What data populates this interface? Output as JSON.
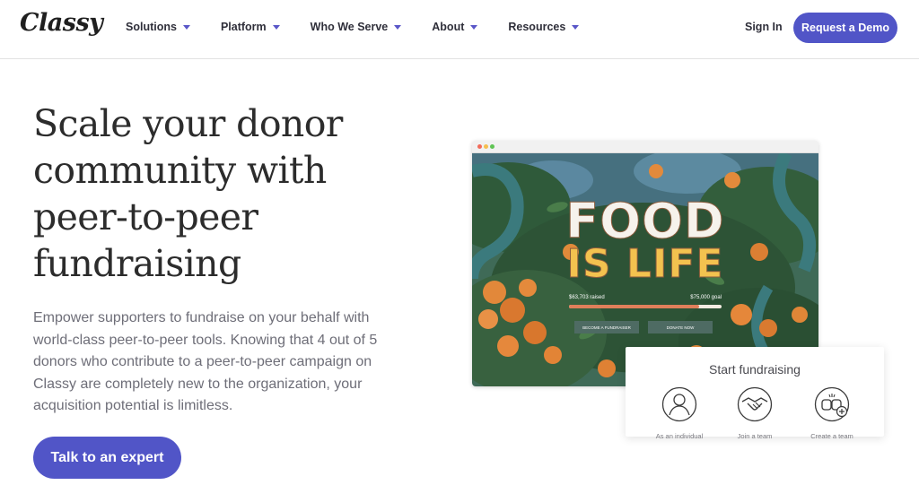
{
  "header": {
    "logo": "Classy",
    "nav": [
      {
        "label": "Solutions"
      },
      {
        "label": "Platform"
      },
      {
        "label": "Who We Serve"
      },
      {
        "label": "About"
      },
      {
        "label": "Resources"
      }
    ],
    "sign_in": "Sign In",
    "demo_button": "Request a Demo"
  },
  "hero": {
    "title": "Scale your donor community with peer-to-peer fundraising",
    "body": "Empower supporters to fundraise on your behalf with world-class peer-to-peer tools. Knowing that 4 out of 5 donors who contribute to a peer-to-peer campaign on Classy are completely new to the organization, your acquisition potential is limitless.",
    "cta": "Talk to an expert"
  },
  "mockup": {
    "title_line1": "FOOD",
    "title_line2": "IS LIFE",
    "raised_amount": "$63,703",
    "raised_label": "raised",
    "goal_amount": "$75,000",
    "goal_label": "goal",
    "progress_fraction": 0.85,
    "button_fundraiser": "BECOME A FUNDRAISER",
    "button_donate": "DONATE NOW"
  },
  "fundraising_card": {
    "title": "Start fundraising",
    "options": [
      {
        "label": "As an individual",
        "icon": "person-icon"
      },
      {
        "label": "Join a team",
        "icon": "handshake-icon"
      },
      {
        "label": "Create a team",
        "icon": "fist-bump-plus-icon"
      }
    ]
  },
  "colors": {
    "brand": "#5155c7",
    "title_cream": "#f6f2ec",
    "title_yellow": "#f3c24f",
    "progress": "#e07f5a",
    "button_green": "#4e6b63"
  }
}
